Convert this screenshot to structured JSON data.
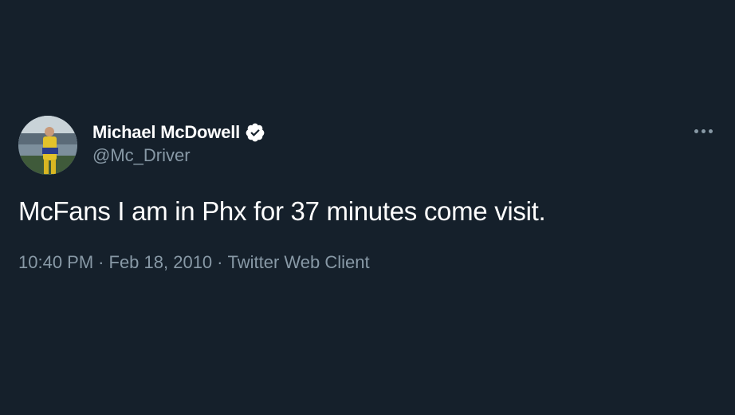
{
  "tweet": {
    "author": {
      "display_name": "Michael McDowell",
      "handle": "@Mc_Driver",
      "verified": true,
      "avatar_icon": "racer-avatar"
    },
    "text": "McFans I am in Phx for 37 minutes come visit.",
    "time": "10:40 PM",
    "date": "Feb 18, 2010",
    "client": "Twitter Web Client",
    "separator": "·",
    "more_icon": "more-options-icon"
  },
  "colors": {
    "background": "#15202b",
    "primary_text": "#ffffff",
    "secondary_text": "#8899a6"
  }
}
